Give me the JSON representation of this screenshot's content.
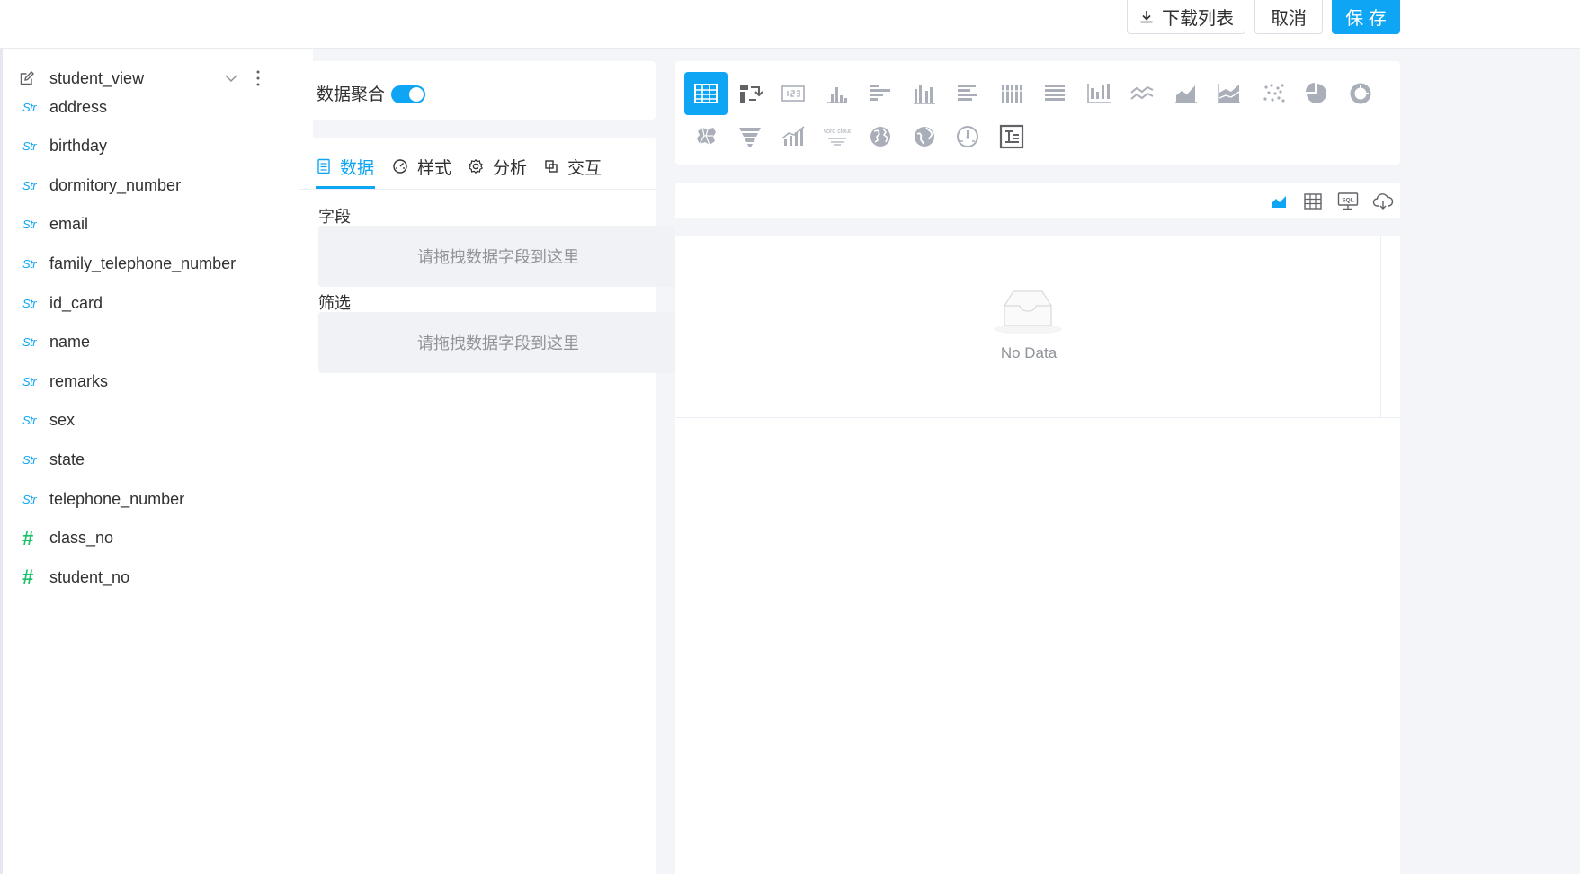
{
  "header": {
    "download_label": "下载列表",
    "cancel_label": "取消",
    "save_label": "保 存"
  },
  "dataset": {
    "view_name": "student_view",
    "fields": [
      {
        "type": "Str",
        "name": "address"
      },
      {
        "type": "Str",
        "name": "birthday"
      },
      {
        "type": "Str",
        "name": "dormitory_number"
      },
      {
        "type": "Str",
        "name": "email"
      },
      {
        "type": "Str",
        "name": "family_telephone_number"
      },
      {
        "type": "Str",
        "name": "id_card"
      },
      {
        "type": "Str",
        "name": "name"
      },
      {
        "type": "Str",
        "name": "remarks"
      },
      {
        "type": "Str",
        "name": "sex"
      },
      {
        "type": "Str",
        "name": "state"
      },
      {
        "type": "Str",
        "name": "telephone_number"
      },
      {
        "type": "#",
        "name": "class_no"
      },
      {
        "type": "#",
        "name": "student_no"
      }
    ]
  },
  "config": {
    "aggregate_label": "数据聚合",
    "aggregate_on": true,
    "tabs": [
      {
        "label": "数据",
        "icon": "list-icon",
        "active": true
      },
      {
        "label": "样式",
        "icon": "gauge-icon",
        "active": false
      },
      {
        "label": "分析",
        "icon": "gear-icon",
        "active": false
      },
      {
        "label": "交互",
        "icon": "copy-icon",
        "active": false
      }
    ],
    "fields_label": "字段",
    "fields_placeholder": "请拖拽数据字段到这里",
    "filter_label": "筛选",
    "filter_placeholder": "请拖拽数据字段到这里"
  },
  "chart_types": {
    "icons": [
      "table-icon",
      "pivot-table-icon",
      "kpi-card-icon",
      "bar-chart-icon",
      "horizontal-bar-icon",
      "grouped-bar-icon",
      "horizontal-grouped-bar-icon",
      "stacked-bar-icon",
      "horizontal-stacked-bar-icon",
      "percent-bar-icon",
      "line-chart-icon",
      "area-chart-icon",
      "stacked-area-icon",
      "scatter-icon",
      "pie-icon",
      "donut-icon",
      "map-icon",
      "funnel-icon",
      "combo-chart-icon",
      "word-cloud-icon",
      "globe-icon",
      "world-map-icon",
      "gauge-chart-icon",
      "rich-text-icon"
    ],
    "accent": "#0ea5f4",
    "word_cloud_text": "word cloud"
  },
  "preview": {
    "toolbar_icons": [
      "chart-view-icon",
      "table-view-icon",
      "sql-view-icon",
      "cloud-download-icon"
    ],
    "sql_text": "SQL",
    "empty_text": "No Data"
  }
}
